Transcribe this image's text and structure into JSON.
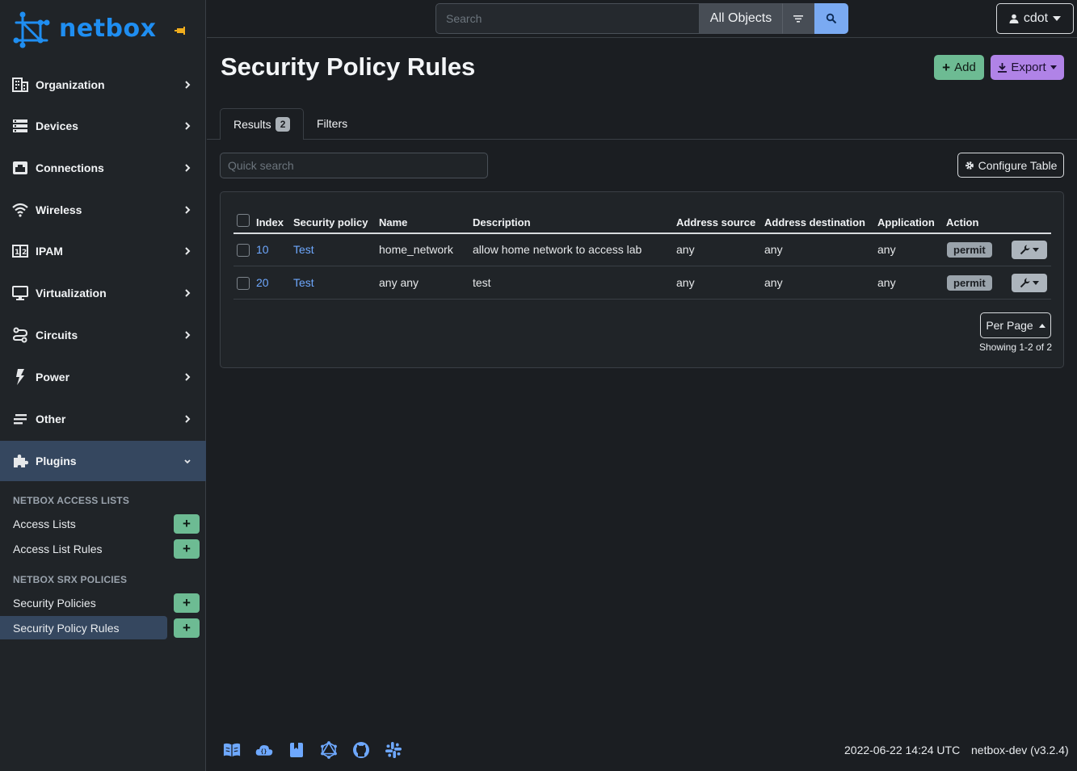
{
  "brand": {
    "name": "netbox"
  },
  "sidebar": {
    "items": [
      {
        "label": "Organization",
        "icon": "building-icon"
      },
      {
        "label": "Devices",
        "icon": "server-icon"
      },
      {
        "label": "Connections",
        "icon": "ethernet-icon"
      },
      {
        "label": "Wireless",
        "icon": "wifi-icon"
      },
      {
        "label": "IPAM",
        "icon": "counter-icon"
      },
      {
        "label": "Virtualization",
        "icon": "monitor-icon"
      },
      {
        "label": "Circuits",
        "icon": "transit-icon"
      },
      {
        "label": "Power",
        "icon": "flash-icon"
      },
      {
        "label": "Other",
        "icon": "notes-icon"
      },
      {
        "label": "Plugins",
        "icon": "puzzle-icon"
      }
    ],
    "sections": [
      {
        "title": "NETBOX ACCESS LISTS",
        "links": [
          "Access Lists",
          "Access List Rules"
        ]
      },
      {
        "title": "NETBOX SRX POLICIES",
        "links": [
          "Security Policies",
          "Security Policy Rules"
        ]
      }
    ]
  },
  "topbar": {
    "search_placeholder": "Search",
    "scope": "All Objects",
    "user": "cdot"
  },
  "page": {
    "title": "Security Policy Rules",
    "add_label": "Add",
    "export_label": "Export",
    "tabs": {
      "results": "Results",
      "results_count": "2",
      "filters": "Filters"
    },
    "quick_search_placeholder": "Quick search",
    "configure_table": "Configure Table"
  },
  "table": {
    "columns": [
      "Index",
      "Security policy",
      "Name",
      "Description",
      "Address source",
      "Address destination",
      "Application",
      "Action"
    ],
    "rows": [
      {
        "index": "10",
        "policy": "Test",
        "name": "home_network",
        "description": "allow home network to access lab",
        "src": "any",
        "dst": "any",
        "app": "any",
        "action": "permit"
      },
      {
        "index": "20",
        "policy": "Test",
        "name": "any any",
        "description": "test",
        "src": "any",
        "dst": "any",
        "app": "any",
        "action": "permit"
      }
    ],
    "per_page": "Per Page",
    "showing": "Showing 1-2 of 2"
  },
  "footer": {
    "icons": [
      "book-icon",
      "cloud-api-icon",
      "bookmark-icon",
      "graphql-icon",
      "github-icon",
      "slack-icon"
    ],
    "datetime": "2022-06-22 14:24 UTC",
    "version": "netbox-dev (v3.2.4)"
  },
  "colors": {
    "accent": "#1f8ef1",
    "success": "#6dbb93",
    "export": "#b083e7",
    "link": "#6ea8fe",
    "active_nav": "#35475f"
  }
}
